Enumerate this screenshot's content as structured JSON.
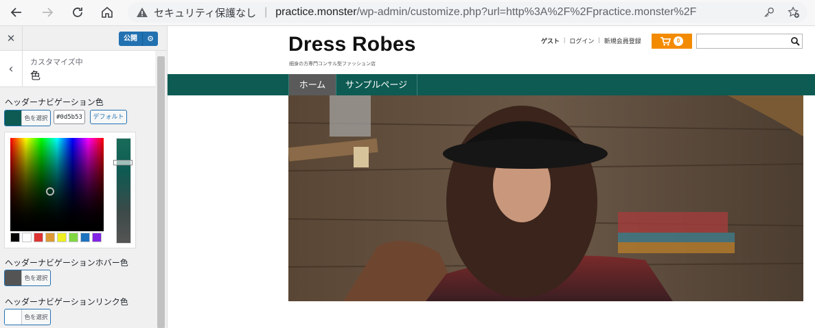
{
  "browser": {
    "warning_text": "セキュリティ保護なし",
    "url_host": "practice.monster",
    "url_path": "/wp-admin/customize.php?url=http%3A%2F%2Fpractice.monster%2F",
    "icons": [
      "back-arrow-icon",
      "forward-arrow-icon",
      "reload-icon",
      "home-icon",
      "warning-icon",
      "key-icon",
      "add-favorite-icon"
    ]
  },
  "customizer": {
    "publish_label": "公開",
    "breadcrumb_small": "カスタマイズ中",
    "section_title": "色",
    "controls": [
      {
        "label": "ヘッダーナビゲーション色",
        "select_label": "色を選択",
        "color": "#0d5b53",
        "hex_value": "#0d5b53",
        "default_label": "デフォルト"
      },
      {
        "label": "ヘッダーナビゲーションホバー色",
        "select_label": "色を選択",
        "color": "#545454"
      },
      {
        "label": "ヘッダーナビゲーションリンク色",
        "select_label": "色を選択",
        "color": "#ffffff"
      }
    ],
    "palette": [
      "#000000",
      "#ffffff",
      "#dd3333",
      "#dd9933",
      "#eeee22",
      "#81d742",
      "#1e73be",
      "#8224e3"
    ]
  },
  "site": {
    "title": "Dress Robes",
    "tagline": "細身の方専門コンサル型ファッション店",
    "links": {
      "guest": "ゲスト",
      "login": "ログイン",
      "register": "新規会員登録",
      "separator": "|"
    },
    "cart_count": "0",
    "search_value": "",
    "nav": {
      "home": "ホーム",
      "sample": "サンプルページ"
    },
    "nav_color": "#0d5b53",
    "accent_color": "#f38b00"
  }
}
